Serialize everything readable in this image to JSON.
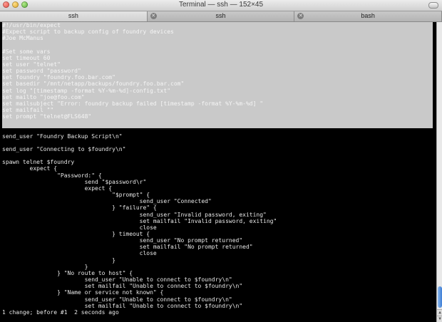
{
  "window": {
    "title": "Terminal — ssh — 152×45"
  },
  "tabs": [
    {
      "label": "ssh",
      "active": true
    },
    {
      "label": "ssh",
      "active": false
    },
    {
      "label": "bash",
      "active": false
    }
  ],
  "terminal": {
    "selected_line_count": 16,
    "lines": [
      "#!/usr/bin/expect",
      "#Expect script to backup config of foundry devices",
      "#Joe McManus",
      "",
      "#Set some vars",
      "set timeout 60",
      "set user \"telnet\"",
      "set password \"password\"",
      "set foundry \"foundry.foo.bar.com\"",
      "set basedir \"/mnt/netapp/backups/foundry.foo.bar.com\"",
      "set log \"[timestamp -format %Y-%m-%d]-config.txt\"",
      "set mailto \"joe@foo.com\"",
      "set mailsubject \"Error: foundry backup failed [timestamp -format %Y-%m-%d] \"",
      "set mailfail \"\"",
      "set prompt \"telnet@FLS648\"",
      "",
      "",
      "send_user \"Foundry Backup Script\\n\"",
      "",
      "send_user \"Connecting to $foundry\\n\"",
      "",
      "spawn telnet $foundry",
      "        expect {",
      "                \"Password:\" {",
      "                        send \"$password\\r\"",
      "                        expect {",
      "                                \"$prompt\" {",
      "                                        send_user \"Connected\"",
      "                                } \"failure\" {",
      "                                        send_user \"Invalid password, exiting\"",
      "                                        set mailfail \"Invalid password, exiting\"",
      "                                        close",
      "                                } timeout {",
      "                                        send_user \"No prompt returned\"",
      "                                        set mailfail \"No prompt returned\"",
      "                                        close",
      "                                }",
      "                        }",
      "                } \"No route to host\" {",
      "                        send_user \"Unable to connect to $foundry\\n\"",
      "                        set mailfail \"Unable to connect to $foundry\\n\"",
      "                } \"Name or service not known\" {",
      "                        send_user \"Unable to connect to $foundry\\n\"",
      "                        set mailfail \"Unable to connect to $foundry\\n\"",
      "1 change; before #1  2 seconds ago"
    ]
  }
}
